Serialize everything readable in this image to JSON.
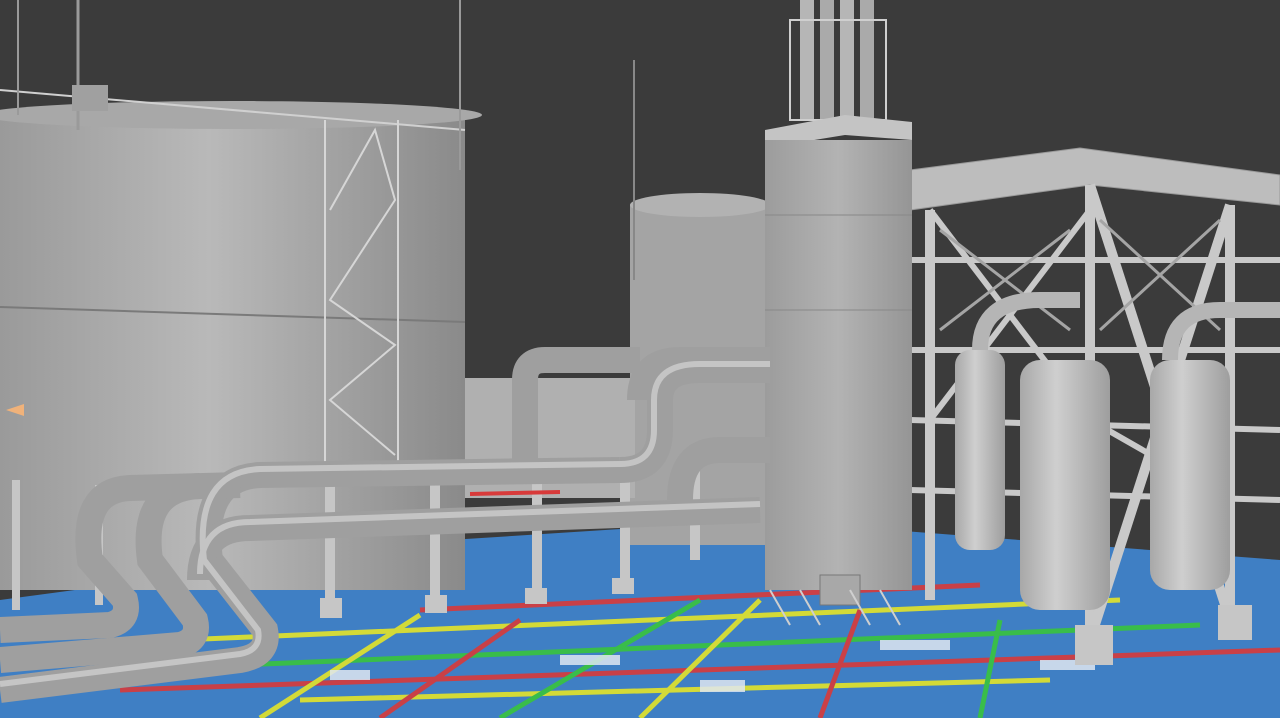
{
  "scene": {
    "background_color": "#3a3a3a",
    "ground_color": "#3f7fc4",
    "steel_color": "#b8b8b8",
    "pipe_color": "#a9a9a9",
    "cable_colors": [
      "#e4e429",
      "#39c43d",
      "#d83a3a",
      "#cfd7e5"
    ]
  }
}
